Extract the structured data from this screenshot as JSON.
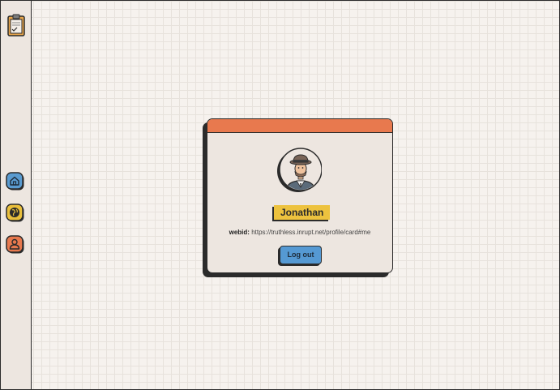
{
  "sidebar": {
    "icons": [
      {
        "name": "clipboard-icon"
      },
      {
        "name": "home-icon",
        "color": "#5a9bd0"
      },
      {
        "name": "globe-icon",
        "color": "#e9bf3c"
      },
      {
        "name": "person-icon",
        "color": "#e8794e"
      }
    ]
  },
  "profile": {
    "header_color": "#e8794e",
    "avatar": "detective-avatar",
    "name": "Jonathan",
    "webid_label": "webid:",
    "webid_value": "https://truthless.inrupt.net/profile/card#me",
    "logout_label": "Log out",
    "logout_color": "#5599d3",
    "name_tag_color": "#edc23e"
  }
}
